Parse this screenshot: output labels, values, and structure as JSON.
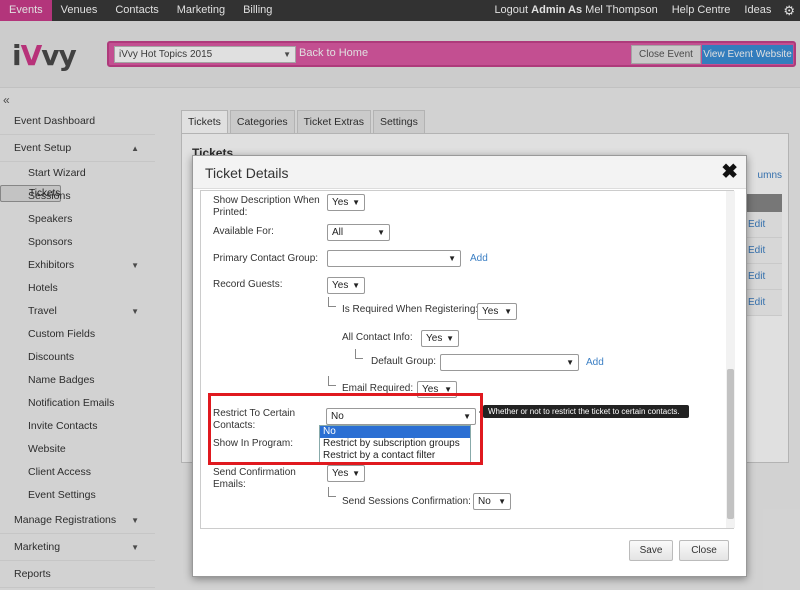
{
  "topnav": {
    "left": [
      "Events",
      "Venues",
      "Contacts",
      "Marketing",
      "Billing"
    ],
    "logout": "Logout",
    "admin_as": "Admin As",
    "user": "Mel Thompson",
    "help": "Help Centre",
    "ideas": "Ideas",
    "gear_icon": "gear-icon"
  },
  "header": {
    "logo": "iVvy",
    "event_select": "iVvy Hot Topics 2015",
    "back_home": "Back to Home",
    "close_event": "Close Event",
    "view_site": "View Event Website",
    "brand_color": "#de5ba6"
  },
  "sidebar": {
    "collapse": "«",
    "items": [
      {
        "label": "Event Dashboard",
        "level": "top"
      },
      {
        "label": "Event Setup",
        "level": "top",
        "expanded": true
      },
      {
        "label": "Start Wizard",
        "level": "sub"
      },
      {
        "label": "Tickets",
        "level": "sub",
        "selected": true
      },
      {
        "label": "Sessions",
        "level": "sub"
      },
      {
        "label": "Speakers",
        "level": "sub"
      },
      {
        "label": "Sponsors",
        "level": "sub"
      },
      {
        "label": "Exhibitors",
        "level": "sub",
        "has_children": true
      },
      {
        "label": "Hotels",
        "level": "sub"
      },
      {
        "label": "Travel",
        "level": "sub",
        "has_children": true
      },
      {
        "label": "Custom Fields",
        "level": "sub"
      },
      {
        "label": "Discounts",
        "level": "sub"
      },
      {
        "label": "Name Badges",
        "level": "sub"
      },
      {
        "label": "Notification Emails",
        "level": "sub"
      },
      {
        "label": "Invite Contacts",
        "level": "sub"
      },
      {
        "label": "Website",
        "level": "sub"
      },
      {
        "label": "Client Access",
        "level": "sub"
      },
      {
        "label": "Event Settings",
        "level": "sub"
      },
      {
        "label": "Manage Registrations",
        "level": "top",
        "has_children": true
      },
      {
        "label": "Marketing",
        "level": "top",
        "has_children": true
      },
      {
        "label": "Reports",
        "level": "top"
      }
    ]
  },
  "main": {
    "tabs": [
      "Tickets",
      "Categories",
      "Ticket Extras",
      "Settings"
    ],
    "panel_title": "Tickets",
    "columns_link": "umns",
    "edit_labels": [
      "Edit",
      "Edit",
      "Edit",
      "Edit"
    ]
  },
  "modal": {
    "title": "Ticket Details",
    "close": "✖",
    "fields": {
      "show_description": {
        "label": "Show Description When Printed:",
        "value": "Yes"
      },
      "available_for": {
        "label": "Available For:",
        "value": "All"
      },
      "primary_contact_group": {
        "label": "Primary Contact Group:",
        "value": "",
        "link": "Add"
      },
      "record_guests": {
        "label": "Record Guests:",
        "value": "Yes"
      },
      "is_required_when_registering": {
        "label": "Is Required When Registering:",
        "value": "Yes"
      },
      "all_contact_info": {
        "label": "All Contact Info:",
        "value": "Yes"
      },
      "default_group": {
        "label": "Default Group:",
        "value": "",
        "link": "Add"
      },
      "email_required": {
        "label": "Email Required:",
        "value": "Yes"
      },
      "restrict_to_contacts": {
        "label": "Restrict To Certain Contacts:",
        "value": "No"
      },
      "show_in_program": {
        "label": "Show In Program:"
      },
      "send_confirmation_emails": {
        "label": "Send Confirmation Emails:",
        "value": "Yes"
      },
      "send_sessions_confirmation": {
        "label": "Send Sessions Confirmation:",
        "value": "No"
      }
    },
    "dropdown_options": [
      "No",
      "Restrict by subscription groups",
      "Restrict by a contact filter"
    ],
    "dropdown_highlighted": "No",
    "tooltip": "Whether or not to restrict the ticket to certain contacts.",
    "save": "Save",
    "close_button": "Close"
  }
}
